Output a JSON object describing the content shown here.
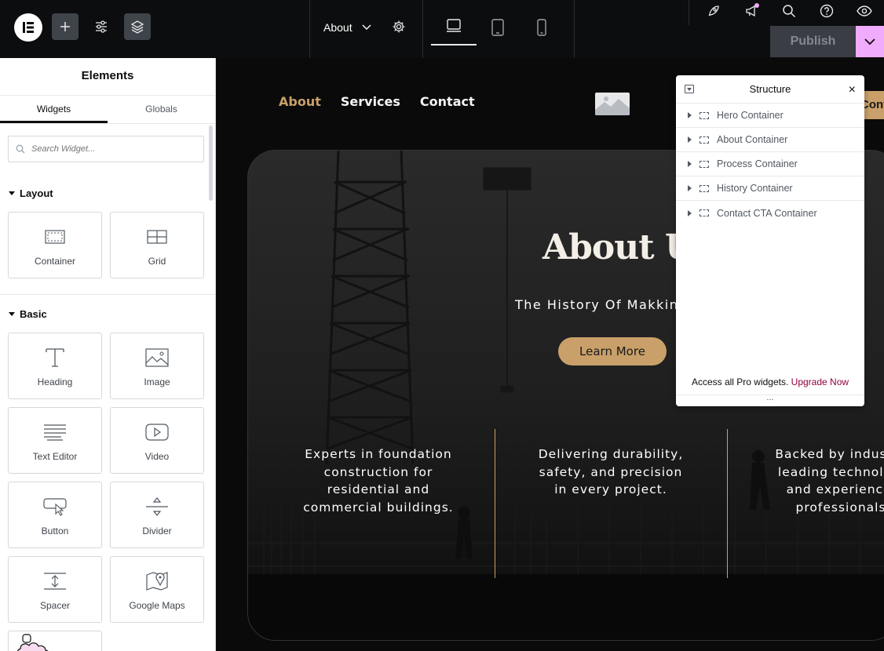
{
  "topbar": {
    "page_name": "About",
    "publish_label": "Publish"
  },
  "panel": {
    "title": "Elements",
    "tabs": [
      "Widgets",
      "Globals"
    ],
    "search_placeholder": "Search Widget...",
    "sections": [
      {
        "title": "Layout",
        "widgets": [
          {
            "label": "Container",
            "icon": "container-icon"
          },
          {
            "label": "Grid",
            "icon": "grid-icon"
          }
        ]
      },
      {
        "title": "Basic",
        "widgets": [
          {
            "label": "Heading",
            "icon": "heading-icon"
          },
          {
            "label": "Image",
            "icon": "image-icon"
          },
          {
            "label": "Text Editor",
            "icon": "text-editor-icon"
          },
          {
            "label": "Video",
            "icon": "video-icon"
          },
          {
            "label": "Button",
            "icon": "button-icon"
          },
          {
            "label": "Divider",
            "icon": "divider-icon"
          },
          {
            "label": "Spacer",
            "icon": "spacer-icon"
          },
          {
            "label": "Google Maps",
            "icon": "google-maps-icon"
          }
        ]
      }
    ]
  },
  "site": {
    "nav": [
      {
        "label": "About",
        "active": true
      },
      {
        "label": "Services",
        "active": false
      },
      {
        "label": "Contact",
        "active": false
      }
    ],
    "cta_peek": "Cont",
    "hero_title": "About Us",
    "hero_subtitle": "The History Of Makkina",
    "learn_more": "Learn More",
    "features": [
      "Experts in foundation construction for residential and commercial buildings.",
      "Delivering durability, safety, and precision in every project.",
      "Backed by industry-leading technology and experienced professionals."
    ],
    "accent_color": "#c9a06a"
  },
  "structure": {
    "title": "Structure",
    "items": [
      "Hero Container",
      "About Container",
      "Process Container",
      "History Container",
      "Contact CTA Container"
    ],
    "upsell_text": "Access all Pro widgets.",
    "upsell_link": "Upgrade Now",
    "footer": "..."
  }
}
